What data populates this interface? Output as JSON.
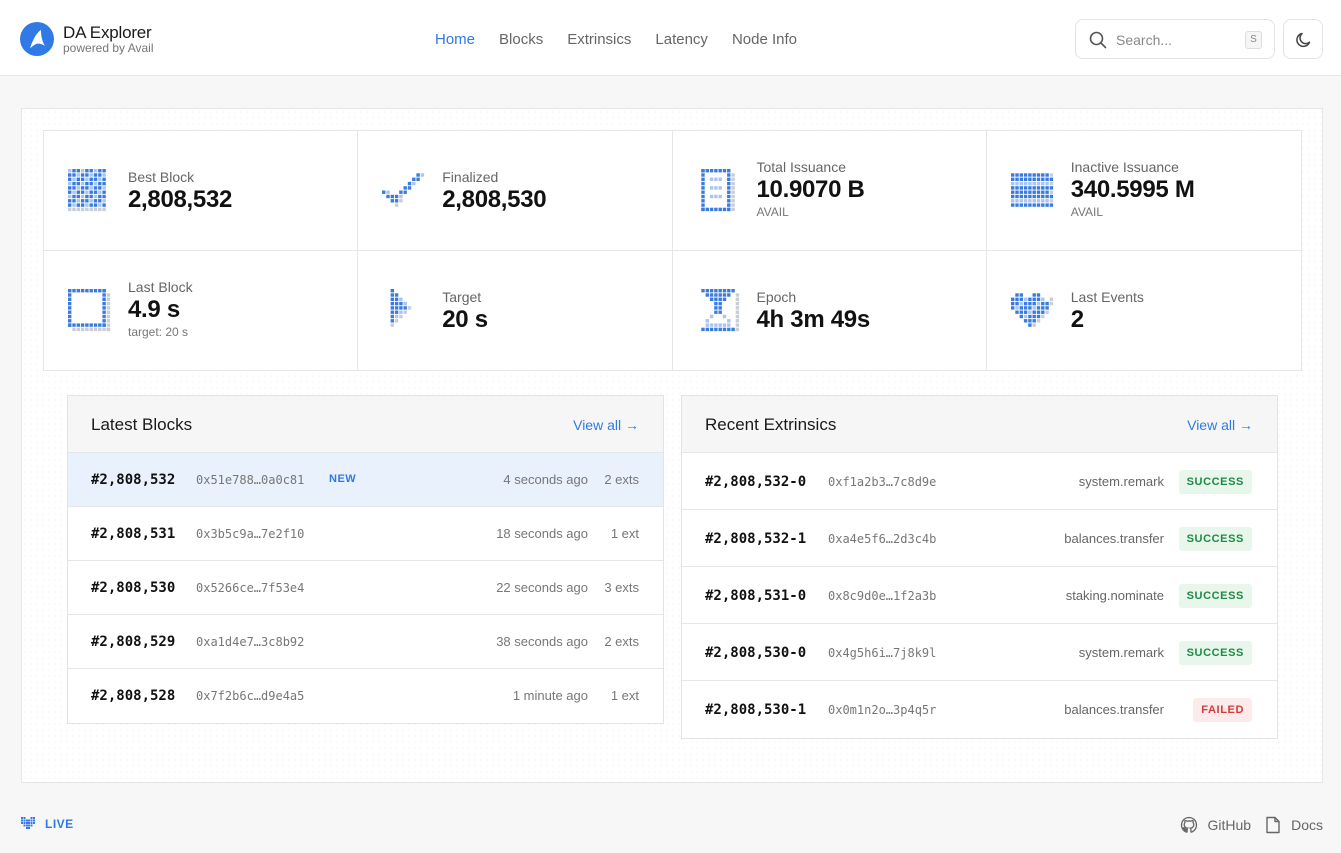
{
  "brand": {
    "title": "DA Explorer",
    "subtitle": "powered by Avail"
  },
  "nav": [
    {
      "label": "Home",
      "active": true
    },
    {
      "label": "Blocks",
      "active": false
    },
    {
      "label": "Extrinsics",
      "active": false
    },
    {
      "label": "Latency",
      "active": false
    },
    {
      "label": "Node Info",
      "active": false
    }
  ],
  "search": {
    "placeholder": "Search...",
    "shortcut": "S"
  },
  "colors": {
    "accent": "#2f7ae5",
    "success": "#1f8a44",
    "failed": "#d33a3a"
  },
  "stats": [
    {
      "label": "Best Block",
      "value": "2,808,532",
      "icon": "grid-icon"
    },
    {
      "label": "Finalized",
      "value": "2,808,530",
      "icon": "checkmark-icon"
    },
    {
      "label": "Total Issuance",
      "value": "10.9070 B",
      "unit": "AVAIL",
      "icon": "document-icon"
    },
    {
      "label": "Inactive Issuance",
      "value": "340.5995 M",
      "unit": "AVAIL",
      "icon": "stack-icon"
    },
    {
      "label": "Last Block",
      "value": "4.9 s",
      "unit": "target: 20 s",
      "icon": "square-frame-icon"
    },
    {
      "label": "Target",
      "value": "20 s",
      "icon": "arrow-right-icon"
    },
    {
      "label": "Epoch",
      "value": "4h 3m 49s",
      "icon": "hourglass-icon"
    },
    {
      "label": "Last Events",
      "value": "2",
      "icon": "heart-icon"
    }
  ],
  "latest_blocks": {
    "title": "Latest Blocks",
    "view_all": "View all →",
    "rows": [
      {
        "number": "#2,808,532",
        "hash": "0x51e788…0a0c81",
        "badge": "NEW",
        "time": "4 seconds ago",
        "exts": "2 exts"
      },
      {
        "number": "#2,808,531",
        "hash": "0x3b5c9a…7e2f10",
        "badge": "",
        "time": "18 seconds ago",
        "exts": "1 ext"
      },
      {
        "number": "#2,808,530",
        "hash": "0x5266ce…7f53e4",
        "badge": "",
        "time": "22 seconds ago",
        "exts": "3 exts"
      },
      {
        "number": "#2,808,529",
        "hash": "0xa1d4e7…3c8b92",
        "badge": "",
        "time": "38 seconds ago",
        "exts": "2 exts"
      },
      {
        "number": "#2,808,528",
        "hash": "0x7f2b6c…d9e4a5",
        "badge": "",
        "time": "1 minute ago",
        "exts": "1 ext"
      }
    ]
  },
  "recent_extrinsics": {
    "title": "Recent Extrinsics",
    "view_all": "View all →",
    "rows": [
      {
        "id": "#2,808,532-0",
        "hash": "0xf1a2b3…7c8d9e",
        "method": "system.remark",
        "status": "SUCCESS"
      },
      {
        "id": "#2,808,532-1",
        "hash": "0xa4e5f6…2d3c4b",
        "method": "balances.transfer",
        "status": "SUCCESS"
      },
      {
        "id": "#2,808,531-0",
        "hash": "0x8c9d0e…1f2a3b",
        "method": "staking.nominate",
        "status": "SUCCESS"
      },
      {
        "id": "#2,808,530-0",
        "hash": "0x4g5h6i…7j8k9l",
        "method": "system.remark",
        "status": "SUCCESS"
      },
      {
        "id": "#2,808,530-1",
        "hash": "0x0m1n2o…3p4q5r",
        "method": "balances.transfer",
        "status": "FAILED"
      }
    ]
  },
  "footer": {
    "live": "LIVE",
    "github": "GitHub",
    "docs": "Docs"
  }
}
